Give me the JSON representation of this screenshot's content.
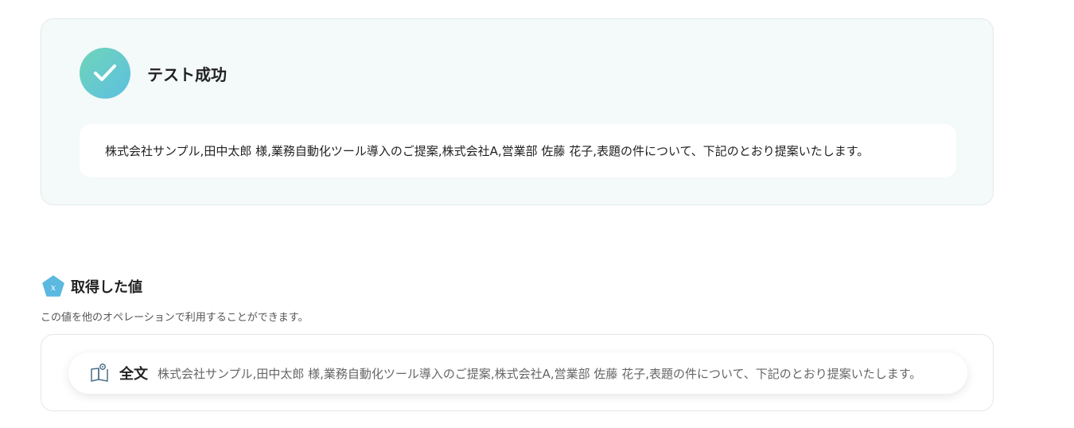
{
  "test_result": {
    "title": "テスト成功",
    "output_text": "株式会社サンプル,田中太郎 様,業務自動化ツール導入のご提案,株式会社A,営業部 佐藤 花子,表題の件について、下記のとおり提案いたします。"
  },
  "acquired_values": {
    "title": "取得した値",
    "description": "この値を他のオペレーションで利用することができます。",
    "items": [
      {
        "label": "全文",
        "value": "株式会社サンプル,田中太郎 様,業務自動化ツール導入のご提案,株式会社A,営業部 佐藤 花子,表題の件について、下記のとおり提案いたします。"
      }
    ]
  },
  "colors": {
    "success_gradient_start": "#6fd5b9",
    "success_gradient_end": "#5dbfe0",
    "card_background": "#f4f9f9",
    "variable_icon": "#5bb8e0"
  },
  "icons": {
    "success": "check-icon",
    "variable": "variable-pentagon-icon",
    "item": "book-icon"
  }
}
